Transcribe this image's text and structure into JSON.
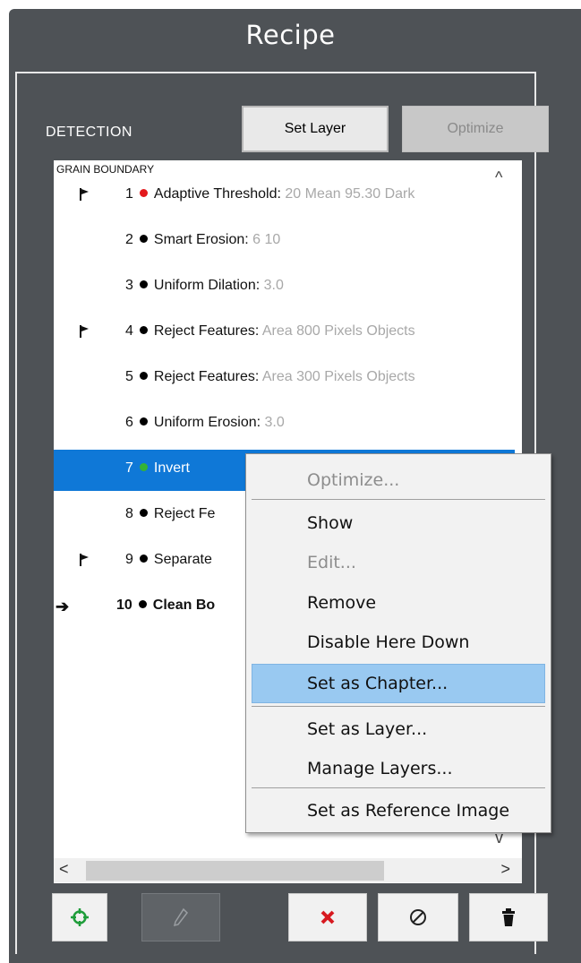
{
  "panel": {
    "title": "Recipe"
  },
  "detection": {
    "label": "DETECTION",
    "set_layer_label": "Set Layer",
    "optimize_label": "Optimize"
  },
  "list": {
    "group_header": "GRAIN BOUNDARY",
    "rows": [
      {
        "num": "1",
        "name": "Adaptive Threshold:",
        "params": " 20 Mean 95.30 Dark",
        "flag": true,
        "dot_color": "#e3191c"
      },
      {
        "num": "2",
        "name": "Smart Erosion:",
        "params": " 6 10",
        "flag": false,
        "dot_color": "#000000"
      },
      {
        "num": "3",
        "name": "Uniform Dilation:",
        "params": " 3.0",
        "flag": false,
        "dot_color": "#000000"
      },
      {
        "num": "4",
        "name": "Reject Features:",
        "params": " Area 800 Pixels Objects",
        "flag": true,
        "dot_color": "#000000"
      },
      {
        "num": "5",
        "name": "Reject Features:",
        "params": " Area 300 Pixels Objects",
        "flag": false,
        "dot_color": "#000000"
      },
      {
        "num": "6",
        "name": "Uniform Erosion:",
        "params": " 3.0",
        "flag": false,
        "dot_color": "#000000"
      },
      {
        "num": "7",
        "name": "Invert",
        "params": "",
        "flag": false,
        "dot_color": "#35b335",
        "selected": true
      },
      {
        "num": "8",
        "name": "Reject Fe",
        "params": "",
        "flag": false,
        "dot_color": "#000000"
      },
      {
        "num": "9",
        "name": "Separate",
        "params": "",
        "flag": true,
        "dot_color": "#000000"
      },
      {
        "num": "10",
        "name": "Clean Bo",
        "params": "",
        "flag": false,
        "dot_color": "#000000",
        "current": true,
        "bold": true
      }
    ]
  },
  "context_menu": {
    "items": [
      {
        "label": "Optimize...",
        "disabled": true
      },
      {
        "label": "Show"
      },
      {
        "label": "Edit...",
        "disabled": true
      },
      {
        "label": "Remove"
      },
      {
        "label": "Disable Here Down"
      },
      {
        "label": "Set as Chapter...",
        "highlighted": true
      },
      {
        "label": "Set as Layer..."
      },
      {
        "label": "Manage Layers..."
      },
      {
        "label": "Set as Reference Image"
      }
    ]
  },
  "toolbar_icons": [
    "crosshair-icon",
    "pencil-icon",
    "delete-x-icon",
    "disable-icon",
    "trash-icon"
  ],
  "colors": {
    "panel_bg": "#4e5256",
    "selection": "#0f78d7",
    "menu_highlight": "#99c9f1",
    "delete_red": "#d71920",
    "crosshair_green": "#1f9d3a"
  }
}
